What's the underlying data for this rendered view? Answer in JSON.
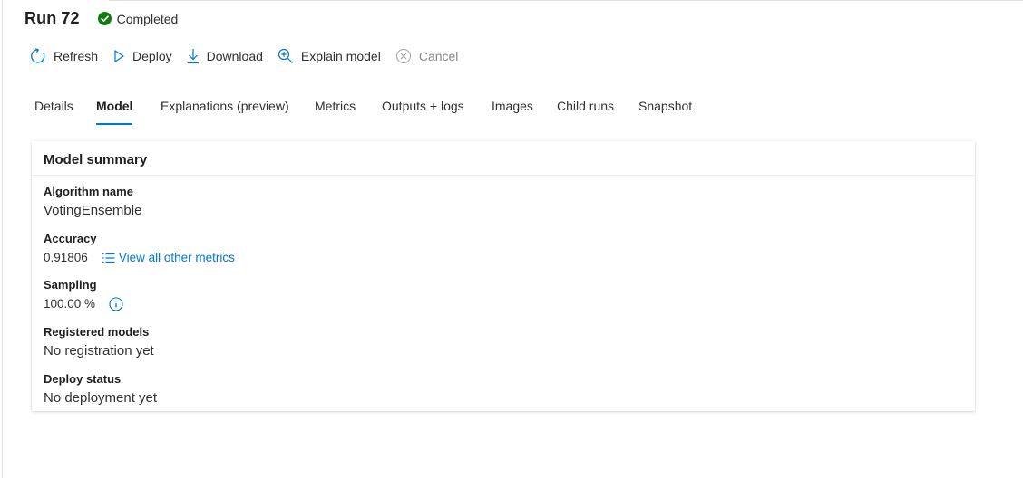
{
  "header": {
    "run_title": "Run 72",
    "status_text": "Completed",
    "status_color": "#107c10"
  },
  "toolbar": {
    "refresh_label": "Refresh",
    "deploy_label": "Deploy",
    "download_label": "Download",
    "explain_label": "Explain model",
    "cancel_label": "Cancel"
  },
  "tabs": [
    {
      "label": "Details",
      "active": false
    },
    {
      "label": "Model",
      "active": true
    },
    {
      "label": "Explanations (preview)",
      "active": false
    },
    {
      "label": "Metrics",
      "active": false
    },
    {
      "label": "Outputs + logs",
      "active": false
    },
    {
      "label": "Images",
      "active": false
    },
    {
      "label": "Child runs",
      "active": false
    },
    {
      "label": "Snapshot",
      "active": false
    }
  ],
  "model_summary": {
    "title": "Model summary",
    "algorithm_label": "Algorithm name",
    "algorithm_value": "VotingEnsemble",
    "accuracy_label": "Accuracy",
    "accuracy_value": "0.91806",
    "metrics_link": "View all other metrics",
    "sampling_label": "Sampling",
    "sampling_value": "100.00 %",
    "registered_label": "Registered models",
    "registered_value": "No registration yet",
    "deploy_label": "Deploy status",
    "deploy_value": "No deployment yet"
  },
  "colors": {
    "accent": "#0078d4",
    "success": "#107c10"
  }
}
